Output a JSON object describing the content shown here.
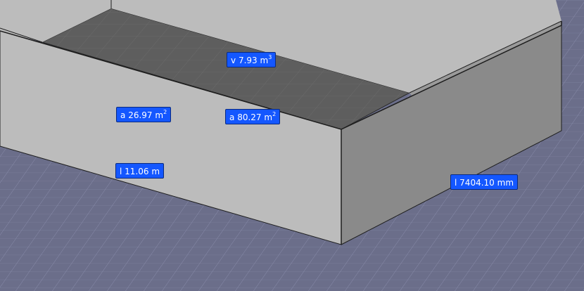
{
  "colors": {
    "background": "#6b6e8a",
    "grid_line": "#8c8fae",
    "floor": "#5e5e5e",
    "floor_grid": "#6e6e6e",
    "wall_light": "#bcbcbc",
    "wall_dark": "#8a8a8a",
    "edge": "#1e1e1e",
    "label_bg": "#1457ff",
    "label_text": "#ffffff"
  },
  "labels": {
    "volume": {
      "prefix": "v",
      "value": "7.93",
      "unit": "m",
      "sup": "3"
    },
    "area_left": {
      "prefix": "a",
      "value": "26.97",
      "unit": "m",
      "sup": "2"
    },
    "area_floor": {
      "prefix": "a",
      "value": "80.27",
      "unit": "m",
      "sup": "2"
    },
    "length_left": {
      "prefix": "l",
      "value": "11.06",
      "unit": "m"
    },
    "length_right": {
      "prefix": "l",
      "value": "7404.10",
      "unit": "mm"
    }
  }
}
